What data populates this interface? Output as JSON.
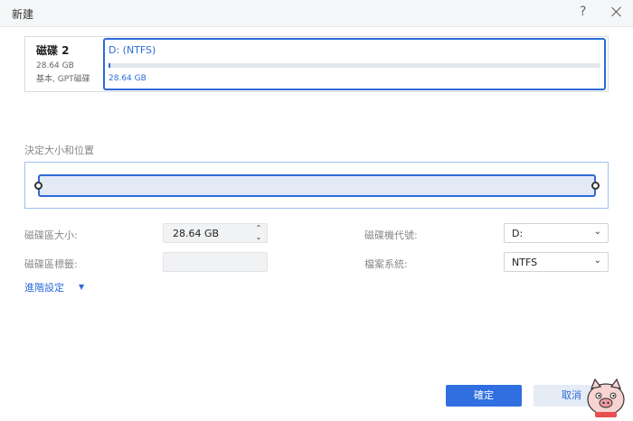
{
  "window": {
    "title": "新建",
    "help_icon": "question-mark-icon",
    "close_icon": "close-icon"
  },
  "disk": {
    "name": "磁碟 2",
    "size": "28.64 GB",
    "type": "基本, GPT磁碟",
    "partition": {
      "label": "D: (NTFS)",
      "size": "28.64 GB",
      "used_fraction": 0.002
    }
  },
  "resize": {
    "label": "決定大小和位置"
  },
  "fields": {
    "partition_size": {
      "label": "磁碟區大小:",
      "value": "28.64 GB"
    },
    "partition_label": {
      "label": "磁碟區標籤:",
      "value": ""
    },
    "drive_letter": {
      "label": "磁碟機代號:",
      "value": "D:"
    },
    "file_system": {
      "label": "檔案系統:",
      "value": "NTFS"
    }
  },
  "advanced": {
    "label": "進階設定"
  },
  "buttons": {
    "ok": "確定",
    "cancel": "取消"
  },
  "colors": {
    "accent": "#2d6bd6",
    "primary_button": "#2f6fe0"
  }
}
